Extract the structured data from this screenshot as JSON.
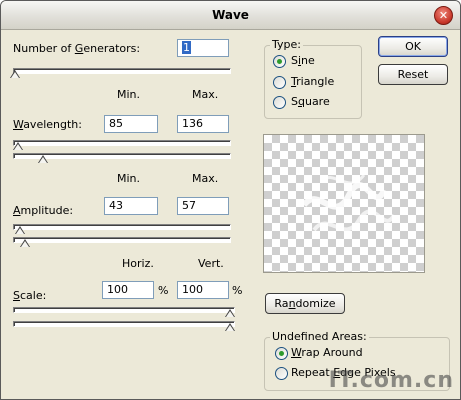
{
  "window": {
    "title": "Wave"
  },
  "generators": {
    "label": "Number of Generators:",
    "label_u": "G",
    "value": "1"
  },
  "wavelength": {
    "col_min": "Min.",
    "col_max": "Max.",
    "label_pre": "",
    "label_u": "W",
    "label_post": "avelength:",
    "min": "85",
    "max": "136"
  },
  "amplitude": {
    "col_min": "Min.",
    "col_max": "Max.",
    "label_pre": "",
    "label_u": "A",
    "label_post": "mplitude:",
    "min": "43",
    "max": "57"
  },
  "scale": {
    "col_horiz": "Horiz.",
    "col_vert": "Vert.",
    "label_u": "S",
    "label_post": "cale:",
    "horiz": "100",
    "vert": "100",
    "unit": "%"
  },
  "type": {
    "legend": "Type:",
    "options": [
      {
        "pre": "S",
        "u": "i",
        "post": "ne",
        "selected": true
      },
      {
        "pre": "",
        "u": "T",
        "post": "riangle",
        "selected": false
      },
      {
        "pre": "S",
        "u": "q",
        "post": "uare",
        "selected": false
      }
    ]
  },
  "buttons": {
    "ok": "OK",
    "reset": "Reset",
    "randomize_pre": "Ra",
    "randomize_u": "n",
    "randomize_post": "domize"
  },
  "undefined_areas": {
    "legend": "Undefined Areas:",
    "options": [
      {
        "pre": "",
        "u": "W",
        "post": "rap Around",
        "selected": true
      },
      {
        "pre": "Repeat ",
        "u": "E",
        "post": "dge Pixels",
        "selected": false
      }
    ]
  },
  "watermark": "IT.com.cn"
}
